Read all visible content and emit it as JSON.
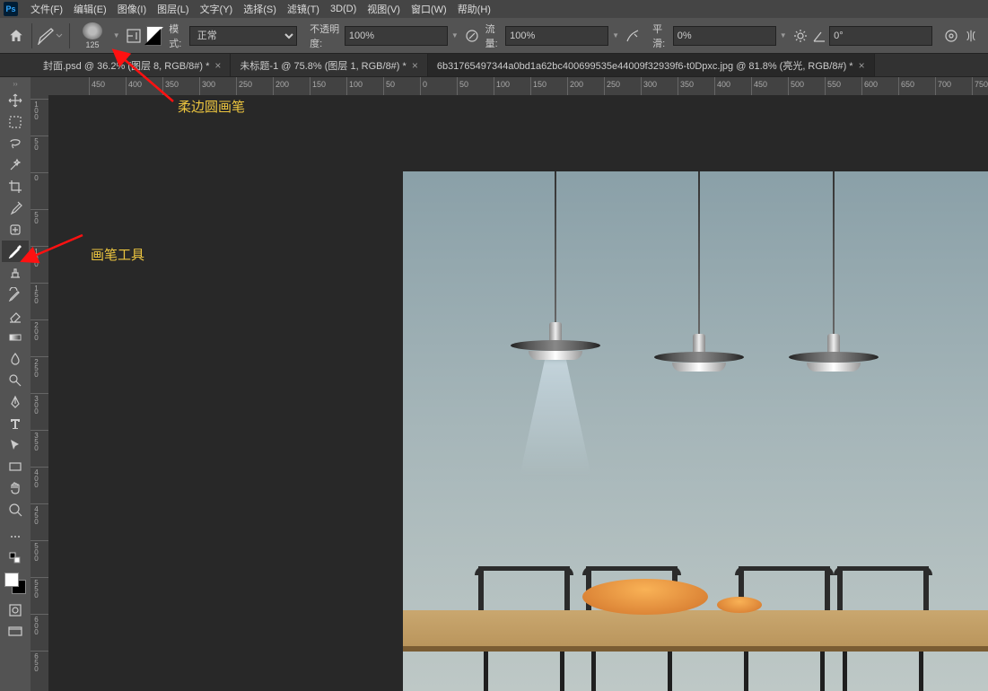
{
  "menu": {
    "items": [
      "文件(F)",
      "编辑(E)",
      "图像(I)",
      "图层(L)",
      "文字(Y)",
      "选择(S)",
      "滤镜(T)",
      "3D(D)",
      "视图(V)",
      "窗口(W)",
      "帮助(H)"
    ]
  },
  "options": {
    "brush_size": "125",
    "mode_label": "模式:",
    "mode_value": "正常",
    "opacity_label": "不透明度:",
    "opacity_value": "100%",
    "flow_label": "流量:",
    "flow_value": "100%",
    "smoothing_label": "平滑:",
    "smoothing_value": "0%",
    "angle_value": "0°"
  },
  "tabs": [
    {
      "label": "封面.psd @ 36.2% (图层 8, RGB/8#) *",
      "active": false
    },
    {
      "label": "未标题-1 @ 75.8% (图层 1, RGB/8#) *",
      "active": false
    },
    {
      "label": "6b31765497344a0bd1a62bc400699535e44009f32939f6-t0Dpxc.jpg @ 81.8% (亮光, RGB/8#) *",
      "active": true
    }
  ],
  "ruler_h": [
    "50",
    "100",
    "150",
    "200",
    "250",
    "300",
    "350",
    "400",
    "450",
    "500",
    "550",
    "600",
    "650",
    "700",
    "750"
  ],
  "ruler_h_neg": [
    "450",
    "400",
    "350",
    "300",
    "250",
    "200",
    "150",
    "100",
    "50",
    "0"
  ],
  "ruler_v": [
    "100",
    "50",
    "0",
    "50",
    "100",
    "150",
    "200",
    "250",
    "300",
    "350",
    "400",
    "450",
    "500",
    "550",
    "600",
    "650"
  ],
  "annotations": {
    "brush_preset": "柔边圆画笔",
    "brush_tool": "画笔工具"
  },
  "tools": [
    "move",
    "rect-marquee",
    "lasso",
    "magic-wand",
    "crop",
    "eyedropper",
    "healing",
    "brush",
    "clone",
    "history-brush",
    "eraser",
    "gradient",
    "blur",
    "dodge",
    "pen",
    "type",
    "path-select",
    "rectangle",
    "hand",
    "zoom"
  ]
}
